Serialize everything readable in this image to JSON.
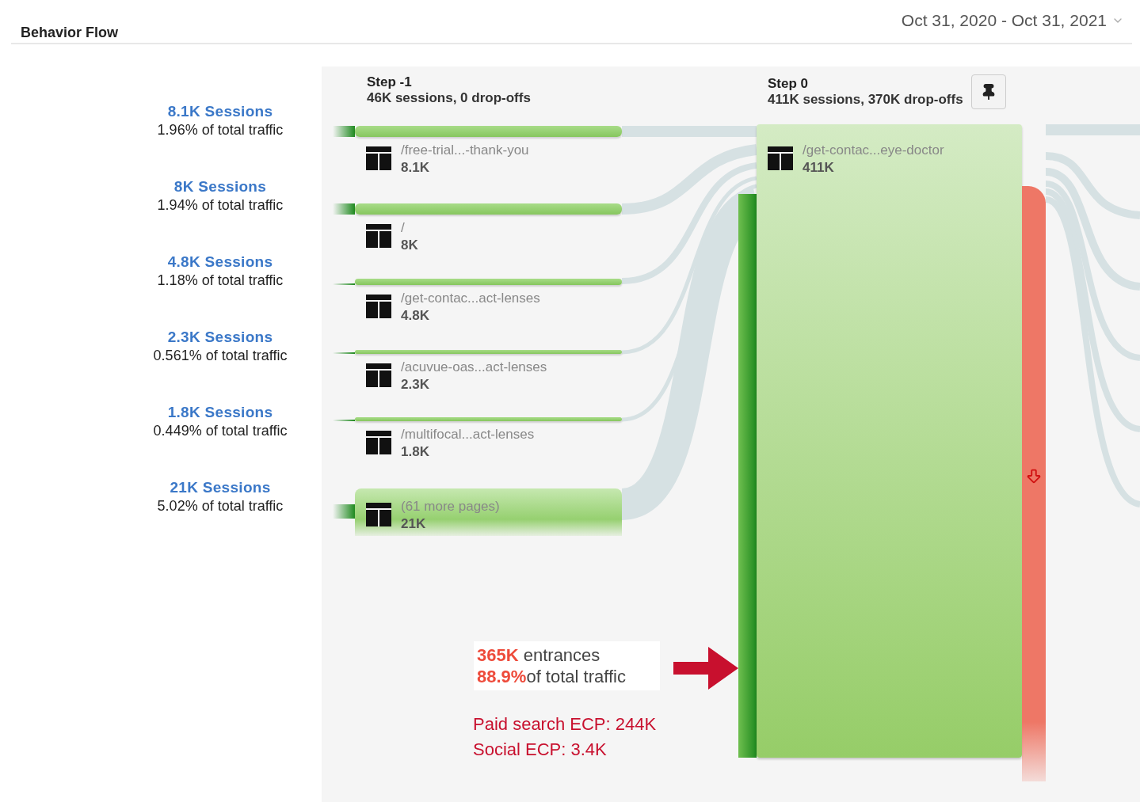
{
  "header": {
    "title": "Behavior Flow",
    "date_range": "Oct 31, 2020 - Oct 31, 2021"
  },
  "sources": [
    {
      "sessions": "8.1K Sessions",
      "share": "1.96% of total traffic"
    },
    {
      "sessions": "8K Sessions",
      "share": "1.94% of total traffic"
    },
    {
      "sessions": "4.8K Sessions",
      "share": "1.18% of total traffic"
    },
    {
      "sessions": "2.3K Sessions",
      "share": "0.561% of total traffic"
    },
    {
      "sessions": "1.8K Sessions",
      "share": "0.449% of total traffic"
    },
    {
      "sessions": "21K Sessions",
      "share": "5.02% of total traffic"
    }
  ],
  "steps": [
    {
      "title": "Step -1",
      "summary": "46K sessions, 0 drop-offs"
    },
    {
      "title": "Step 0",
      "summary": "411K sessions, 370K drop-offs"
    }
  ],
  "step_minus_1_nodes": [
    {
      "kind": "thick",
      "page": "/free-trial...-thank-you",
      "count": "8.1K"
    },
    {
      "kind": "thick",
      "page": "/",
      "count": "8K"
    },
    {
      "kind": "medium",
      "page": "/get-contac...act-lenses",
      "count": "4.8K"
    },
    {
      "kind": "thin",
      "page": "/acuvue-oas...act-lenses",
      "count": "2.3K"
    },
    {
      "kind": "thin",
      "page": "/multifocal...act-lenses",
      "count": "1.8K"
    },
    {
      "kind": "block",
      "page": "(61 more pages)",
      "count": "21K"
    }
  ],
  "step_0_node": {
    "page": "/get-contac...eye-doctor",
    "count": "411K"
  },
  "annotation": {
    "entrances_value": "365K",
    "entrances_label": "entrances",
    "share_value": "88.9%",
    "share_label": "of total traffic"
  },
  "notes": [
    "Paid search ECP: 244K",
    "Social ECP: 3.4K"
  ]
}
